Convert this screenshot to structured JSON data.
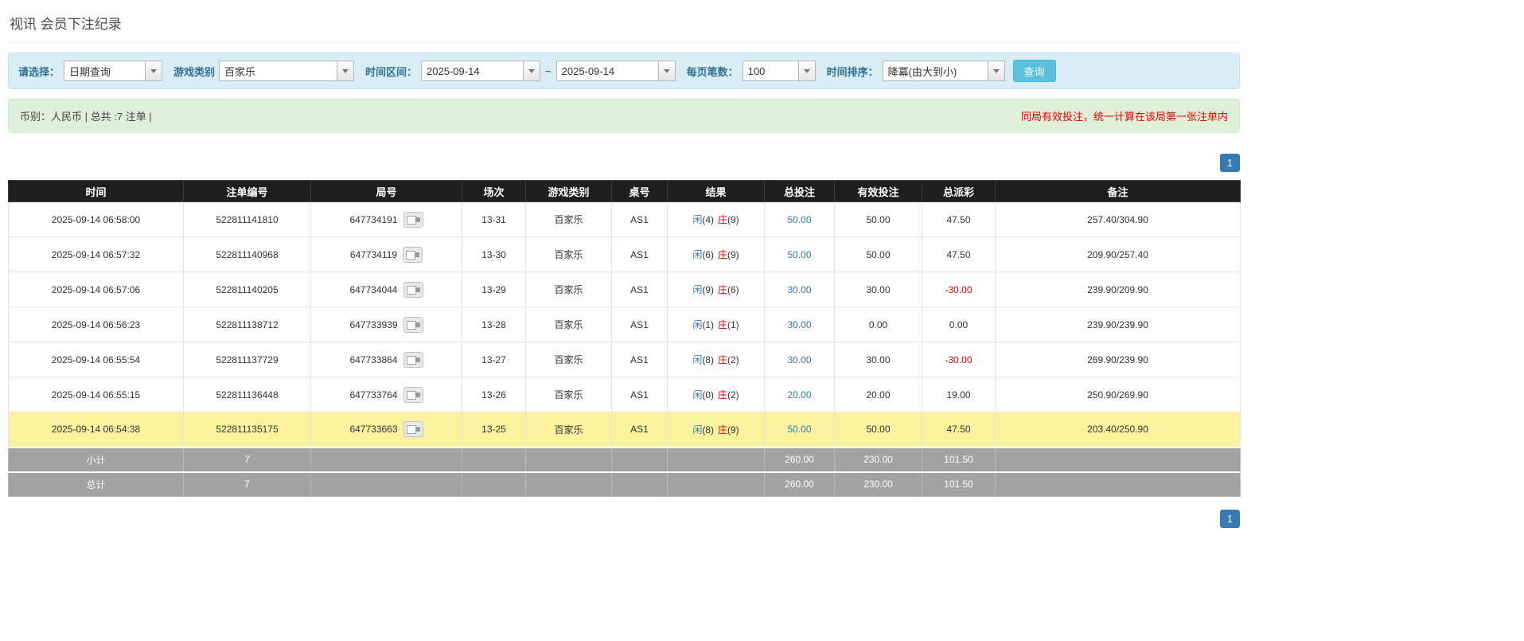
{
  "page": {
    "title": "视讯 会员下注纪录"
  },
  "filters": {
    "select_label": "请选择：",
    "select_value": "日期查询",
    "game_type_label": "游戏类别",
    "game_type_value": "百家乐",
    "date_range_label": "时间区间：",
    "date_from": "2025-09-14",
    "range_separator": "~",
    "date_to": "2025-09-14",
    "page_size_label": "每页笔数：",
    "page_size_value": "100",
    "sort_label": "时间排序：",
    "sort_value": "降冪(由大到小)",
    "search_button": "查询"
  },
  "summary": {
    "left": "币别：人民币 | 总共 :7 注单 |",
    "right": "同局有效投注，统一计算在该局第一张注单内"
  },
  "pagination": {
    "current_page": "1"
  },
  "icons": {
    "combo_arrow": "chevron-down",
    "round_cell": "video-replay"
  },
  "colors": {
    "accent_blue": "#337ab7",
    "search_button": "#5bc0de",
    "filter_bar_bg": "#d9edf7",
    "summary_bar_bg": "#dff0d8",
    "note_red": "#e60000",
    "highlight_row": "#f9f3a0",
    "player_blue": "#337ab7",
    "banker_red": "#dd0000",
    "negative_red": "#dd0000",
    "header_bg": "#1e1e1e",
    "footer_bg": "#a2a2a2"
  },
  "table": {
    "headers": [
      "时间",
      "注单编号",
      "局号",
      "场次",
      "游戏类别",
      "桌号",
      "结果",
      "总投注",
      "有效投注",
      "总派彩",
      "备注"
    ],
    "rows": [
      {
        "time": "2025-09-14 06:58:00",
        "bet_id": "522811141810",
        "round_id": "647734191",
        "session": "13-31",
        "game": "百家乐",
        "table_no": "AS1",
        "player": "闲",
        "player_score": "(4)",
        "banker": "庄",
        "banker_score": "(9)",
        "total_bet": "50.00",
        "valid_bet": "50.00",
        "payout": "47.50",
        "note": "257.40/304.90",
        "highlighted": false
      },
      {
        "time": "2025-09-14 06:57:32",
        "bet_id": "522811140968",
        "round_id": "647734119",
        "session": "13-30",
        "game": "百家乐",
        "table_no": "AS1",
        "player": "闲",
        "player_score": "(6)",
        "banker": "庄",
        "banker_score": "(9)",
        "total_bet": "50.00",
        "valid_bet": "50.00",
        "payout": "47.50",
        "note": "209.90/257.40",
        "highlighted": false
      },
      {
        "time": "2025-09-14 06:57:06",
        "bet_id": "522811140205",
        "round_id": "647734044",
        "session": "13-29",
        "game": "百家乐",
        "table_no": "AS1",
        "player": "闲",
        "player_score": "(9)",
        "banker": "庄",
        "banker_score": "(6)",
        "total_bet": "30.00",
        "valid_bet": "30.00",
        "payout": "-30.00",
        "note": "239.90/209.90",
        "highlighted": false
      },
      {
        "time": "2025-09-14 06:56:23",
        "bet_id": "522811138712",
        "round_id": "647733939",
        "session": "13-28",
        "game": "百家乐",
        "table_no": "AS1",
        "player": "闲",
        "player_score": "(1)",
        "banker": "庄",
        "banker_score": "(1)",
        "total_bet": "30.00",
        "valid_bet": "0.00",
        "payout": "0.00",
        "note": "239.90/239.90",
        "highlighted": false
      },
      {
        "time": "2025-09-14 06:55:54",
        "bet_id": "522811137729",
        "round_id": "647733864",
        "session": "13-27",
        "game": "百家乐",
        "table_no": "AS1",
        "player": "闲",
        "player_score": "(8)",
        "banker": "庄",
        "banker_score": "(2)",
        "total_bet": "30.00",
        "valid_bet": "30.00",
        "payout": "-30.00",
        "note": "269.90/239.90",
        "highlighted": false
      },
      {
        "time": "2025-09-14 06:55:15",
        "bet_id": "522811136448",
        "round_id": "647733764",
        "session": "13-26",
        "game": "百家乐",
        "table_no": "AS1",
        "player": "闲",
        "player_score": "(0)",
        "banker": "庄",
        "banker_score": "(2)",
        "total_bet": "20.00",
        "valid_bet": "20.00",
        "payout": "19.00",
        "note": "250.90/269.90",
        "highlighted": false
      },
      {
        "time": "2025-09-14 06:54:38",
        "bet_id": "522811135175",
        "round_id": "647733663",
        "session": "13-25",
        "game": "百家乐",
        "table_no": "AS1",
        "player": "闲",
        "player_score": "(8)",
        "banker": "庄",
        "banker_score": "(9)",
        "total_bet": "50.00",
        "valid_bet": "50.00",
        "payout": "47.50",
        "note": "203.40/250.90",
        "highlighted": true
      }
    ],
    "subtotal": {
      "label": "小计",
      "count": "7",
      "total_bet": "260.00",
      "valid_bet": "230.00",
      "payout": "101.50"
    },
    "total": {
      "label": "总计",
      "count": "7",
      "total_bet": "260.00",
      "valid_bet": "230.00",
      "payout": "101.50"
    }
  }
}
